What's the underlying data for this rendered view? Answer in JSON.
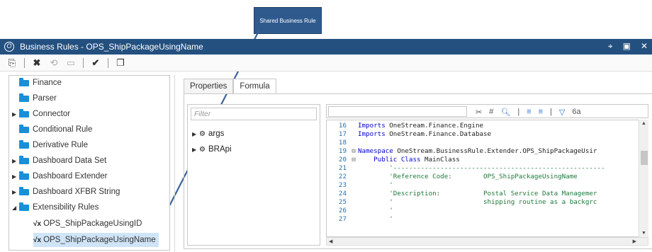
{
  "callout": {
    "text": "Shared Business Rule"
  },
  "window": {
    "title": "Business Rules - OPS_ShipPackageUsingName",
    "logo_glyph": "O",
    "buttons": [
      "pin-icon",
      "restore-icon",
      "close-icon"
    ]
  },
  "toolbar": {
    "items": [
      "new-rule-icon",
      "delete-icon",
      "revert-icon",
      "save-icon",
      "validate-icon",
      "copy-icon"
    ]
  },
  "tree": {
    "items": [
      {
        "label": "Finance",
        "caret": ""
      },
      {
        "label": "Parser",
        "caret": ""
      },
      {
        "label": "Connector",
        "caret": "▶"
      },
      {
        "label": "Conditional Rule",
        "caret": ""
      },
      {
        "label": "Derivative Rule",
        "caret": ""
      },
      {
        "label": "Dashboard Data Set",
        "caret": "▶"
      },
      {
        "label": "Dashboard Extender",
        "caret": "▶"
      },
      {
        "label": "Dashboard XFBR String",
        "caret": "▶"
      },
      {
        "label": "Extensibility Rules",
        "caret": "◢"
      }
    ],
    "children": [
      {
        "label": "OPS_ShipPackageUsingID",
        "icon": "√x",
        "selected": false
      },
      {
        "label": "OPS_ShipPackageUsingName",
        "icon": "√x",
        "selected": true
      }
    ]
  },
  "tabs": [
    {
      "label": "Properties",
      "active": false
    },
    {
      "label": "Formula",
      "active": true
    }
  ],
  "filter": {
    "placeholder": "Filter",
    "items": [
      {
        "label": "args",
        "caret": "▶"
      },
      {
        "label": "BRApi",
        "caret": "▶"
      }
    ]
  },
  "editor": {
    "tools": [
      "#",
      "≡",
      "≡",
      "|",
      "6a"
    ],
    "lines": [
      {
        "n": "16",
        "fold": "",
        "parts": [
          [
            "kw",
            "Imports "
          ],
          [
            "txt",
            "OneStream.Finance.Engine"
          ]
        ]
      },
      {
        "n": "17",
        "fold": "",
        "parts": [
          [
            "kw",
            "Imports "
          ],
          [
            "txt",
            "OneStream.Finance.Database"
          ]
        ]
      },
      {
        "n": "18",
        "fold": "",
        "parts": []
      },
      {
        "n": "19",
        "fold": "⊟",
        "parts": [
          [
            "kw",
            "Namespace "
          ],
          [
            "txt",
            "OneStream.BusinessRule.Extender.OPS_ShipPackageUsir"
          ]
        ]
      },
      {
        "n": "20",
        "fold": "⊟",
        "parts": [
          [
            "kw",
            "    Public Class "
          ],
          [
            "txt",
            "MainClass"
          ]
        ]
      },
      {
        "n": "21",
        "fold": "",
        "parts": [
          [
            "cm",
            "        '------------------------------------------------------"
          ]
        ]
      },
      {
        "n": "22",
        "fold": "",
        "parts": [
          [
            "cm",
            "        'Reference Code:        OPS_ShipPackageUsingName"
          ]
        ]
      },
      {
        "n": "23",
        "fold": "",
        "parts": [
          [
            "cm",
            "        '"
          ]
        ]
      },
      {
        "n": "24",
        "fold": "",
        "parts": [
          [
            "cm",
            "        'Description:           Postal Service Data Managemer"
          ]
        ]
      },
      {
        "n": "25",
        "fold": "",
        "parts": [
          [
            "cm",
            "        '                       shipping routine as a backgrc"
          ]
        ]
      },
      {
        "n": "26",
        "fold": "",
        "parts": [
          [
            "cm",
            "        '"
          ]
        ]
      },
      {
        "n": "27",
        "fold": "",
        "parts": [
          [
            "cm",
            "        '"
          ]
        ]
      }
    ]
  }
}
